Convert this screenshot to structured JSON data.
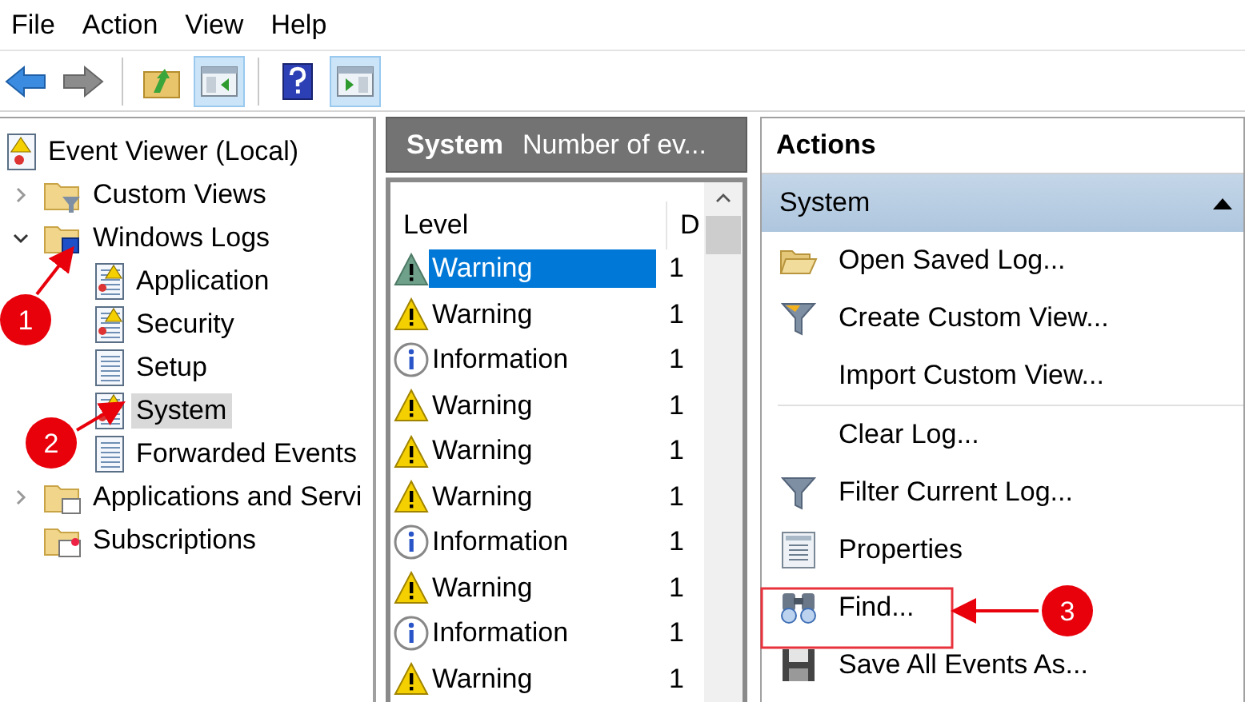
{
  "menu": [
    "File",
    "Action",
    "View",
    "Help"
  ],
  "toolbar": [
    {
      "kind": "back",
      "pressed": false
    },
    {
      "kind": "forward",
      "pressed": false
    },
    {
      "kind": "sep"
    },
    {
      "kind": "up",
      "pressed": false
    },
    {
      "kind": "tree",
      "pressed": true
    },
    {
      "kind": "sep"
    },
    {
      "kind": "help",
      "pressed": false
    },
    {
      "kind": "actionpane",
      "pressed": true
    }
  ],
  "tree": [
    {
      "label": "Event Viewer (Local)",
      "kind": "viewer",
      "selected": false,
      "children": [
        {
          "label": "Custom Views",
          "kind": "folder-filter",
          "expanded": false,
          "selected": false
        },
        {
          "label": "Windows Logs",
          "kind": "folder-logs",
          "expanded": true,
          "selected": false,
          "children": [
            {
              "label": "Application",
              "kind": "log-warning",
              "selected": false
            },
            {
              "label": "Security",
              "kind": "log-warning",
              "selected": false
            },
            {
              "label": "Setup",
              "kind": "log",
              "selected": false
            },
            {
              "label": "System",
              "kind": "log-warning",
              "selected": true
            },
            {
              "label": "Forwarded Events",
              "kind": "log",
              "selected": false
            }
          ]
        },
        {
          "label": "Applications and Servi",
          "kind": "folder",
          "expanded": false,
          "selected": false
        },
        {
          "label": "Subscriptions",
          "kind": "folder-subs",
          "selected": false
        }
      ]
    }
  ],
  "middle": {
    "title": "System",
    "subtitle": "Number of ev...",
    "columns": [
      "Level",
      "D"
    ],
    "rows": [
      {
        "kind": "warning",
        "text": "Warning",
        "column_2": "1",
        "selected": true
      },
      {
        "kind": "warning",
        "text": "Warning",
        "column_2": "1",
        "selected": false
      },
      {
        "kind": "information",
        "text": "Information",
        "column_2": "1",
        "selected": false
      },
      {
        "kind": "warning",
        "text": "Warning",
        "column_2": "1",
        "selected": false
      },
      {
        "kind": "warning",
        "text": "Warning",
        "column_2": "1",
        "selected": false
      },
      {
        "kind": "warning",
        "text": "Warning",
        "column_2": "1",
        "selected": false
      },
      {
        "kind": "information",
        "text": "Information",
        "column_2": "1",
        "selected": false
      },
      {
        "kind": "warning",
        "text": "Warning",
        "column_2": "1",
        "selected": false
      },
      {
        "kind": "information",
        "text": "Information",
        "column_2": "1",
        "selected": false
      },
      {
        "kind": "warning",
        "text": "Warning",
        "column_2": "1",
        "selected": false
      }
    ]
  },
  "actions": {
    "title": "Actions",
    "group": "System",
    "expanded": true,
    "items": [
      {
        "kind": "open",
        "label": "Open Saved Log..."
      },
      {
        "kind": "create-view",
        "label": "Create Custom View..."
      },
      {
        "kind": "none",
        "label": "Import Custom View..."
      },
      {
        "kind": "separator"
      },
      {
        "kind": "none",
        "label": "Clear Log..."
      },
      {
        "kind": "filter",
        "label": "Filter Current Log..."
      },
      {
        "kind": "properties",
        "label": "Properties"
      },
      {
        "kind": "find",
        "label": "Find...",
        "highlighted": true
      },
      {
        "kind": "save",
        "label": "Save All Events As..."
      }
    ]
  },
  "callouts": [
    {
      "number": "1"
    },
    {
      "number": "2"
    },
    {
      "number": "3"
    }
  ]
}
